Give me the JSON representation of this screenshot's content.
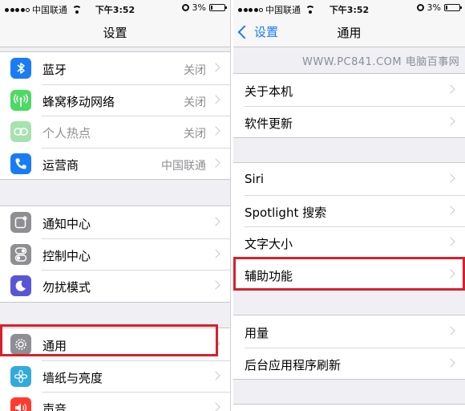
{
  "left": {
    "status": {
      "carrier": "中国联通",
      "time": "下午3:52",
      "battery": "3%"
    },
    "nav": {
      "title": "设置"
    },
    "groups": [
      {
        "items": [
          {
            "label": "蓝牙",
            "value": "关闭",
            "icon": "bluetooth-icon",
            "color": "#1a7cf5"
          },
          {
            "label": "蜂窝移动网络",
            "value": "关闭",
            "icon": "cellular-icon",
            "color": "#4cd964"
          },
          {
            "label": "个人热点",
            "value": "关闭",
            "icon": "hotspot-icon",
            "color": "#a6e2ae",
            "disabled": true
          },
          {
            "label": "运营商",
            "value": "中国联通",
            "icon": "carrier-phone-icon",
            "color": "#1a7cf5"
          }
        ]
      },
      {
        "items": [
          {
            "label": "通知中心",
            "icon": "notification-center-icon",
            "color": "#8e8e93"
          },
          {
            "label": "控制中心",
            "icon": "control-center-icon",
            "color": "#8e8e93"
          },
          {
            "label": "勿扰模式",
            "icon": "moon-icon",
            "color": "#5856d6"
          }
        ]
      },
      {
        "items": [
          {
            "label": "通用",
            "icon": "gear-icon",
            "color": "#8e8e93"
          },
          {
            "label": "墙纸与亮度",
            "icon": "wallpaper-flower-icon",
            "color": "#34aadc"
          },
          {
            "label": "声音",
            "icon": "speaker-icon",
            "color": "#ff3b30"
          }
        ]
      }
    ]
  },
  "right": {
    "status": {
      "carrier": "中国联通",
      "time": "下午3:52",
      "battery": "3%"
    },
    "nav": {
      "back_label": "设置",
      "title": "通用"
    },
    "watermark": "WWW.PC841.COM 电脑百事网",
    "groups": [
      {
        "items": [
          {
            "label": "关于本机"
          },
          {
            "label": "软件更新"
          }
        ]
      },
      {
        "items": [
          {
            "label": "Siri"
          },
          {
            "label": "Spotlight 搜索"
          },
          {
            "label": "文字大小"
          },
          {
            "label": "辅助功能"
          }
        ]
      },
      {
        "items": [
          {
            "label": "用量"
          },
          {
            "label": "后台应用程序刷新"
          }
        ]
      }
    ]
  },
  "colors": {
    "highlight": "#d8202c",
    "accent": "#1a7cf5"
  }
}
